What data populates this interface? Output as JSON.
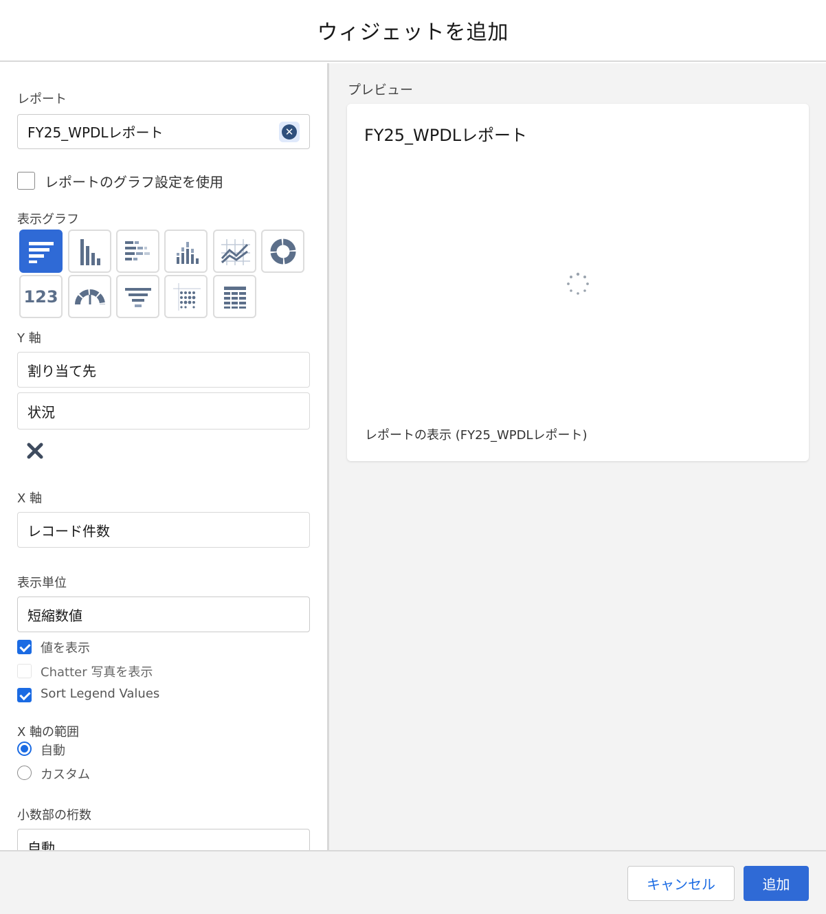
{
  "header": {
    "title": "ウィジェットを追加"
  },
  "left": {
    "report_label": "レポート",
    "report_value": "FY25_WPDLレポート",
    "use_report_chart_label": "レポートのグラフ設定を使用",
    "display_chart_label": "表示グラフ",
    "chart_types": [
      {
        "name": "horizontal-bar",
        "selected": true
      },
      {
        "name": "vertical-bar"
      },
      {
        "name": "stacked-horizontal-bar"
      },
      {
        "name": "stacked-vertical-bar"
      },
      {
        "name": "line"
      },
      {
        "name": "donut"
      },
      {
        "name": "metric",
        "text": "123"
      },
      {
        "name": "gauge"
      },
      {
        "name": "funnel"
      },
      {
        "name": "scatter"
      },
      {
        "name": "table"
      }
    ],
    "y_axis_label": "Y 軸",
    "y_axis_values": [
      "割り当て先",
      "状況"
    ],
    "x_axis_label": "X 軸",
    "x_axis_value": "レコード件数",
    "display_units_label": "表示単位",
    "display_units_value": "短縮数値",
    "options": [
      {
        "label": "値を表示",
        "checked": true
      },
      {
        "label": "Chatter 写真を表示",
        "checked": false,
        "disabled": true
      },
      {
        "label": "Sort Legend Values",
        "checked": true
      }
    ],
    "x_range_label": "X 軸の範囲",
    "x_range_options": [
      {
        "label": "自動",
        "selected": true
      },
      {
        "label": "カスタム",
        "selected": false
      }
    ],
    "decimal_label": "小数部の桁数",
    "decimal_value": "自動"
  },
  "preview": {
    "label": "プレビュー",
    "title": "FY25_WPDLレポート",
    "footer_link": "レポートの表示 (FY25_WPDLレポート)"
  },
  "footer": {
    "cancel_label": "キャンセル",
    "add_label": "追加"
  },
  "colors": {
    "brand": "#2f6ad6",
    "link": "#1b6be3"
  }
}
